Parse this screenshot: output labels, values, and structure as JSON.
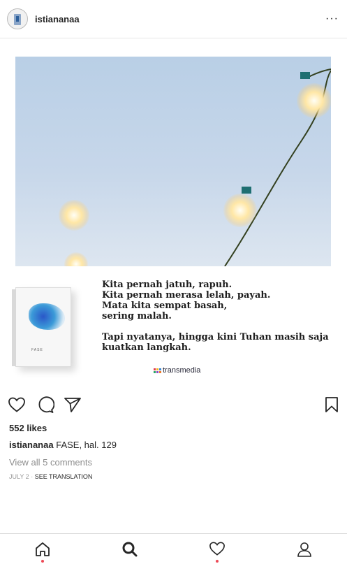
{
  "header": {
    "username": "istiananaa",
    "more_label": "···"
  },
  "post": {
    "quote_lines": [
      "Kita pernah jatuh, rapuh.",
      "Kita pernah merasa lelah, payah.",
      "Mata kita sempat basah,",
      "sering malah.",
      "Tapi nyatanya, hingga kini Tuhan masih saja",
      "kuatkan langkah."
    ],
    "publisher": "transmedia"
  },
  "actions": {
    "like_icon": "heart-icon",
    "comment_icon": "comment-icon",
    "share_icon": "paper-plane-icon",
    "save_icon": "bookmark-icon"
  },
  "likes": "552 likes",
  "caption": {
    "username": "istiananaa",
    "text": "FASE, hal. 129"
  },
  "view_comments": "View all 5 comments",
  "date": "JULY 2",
  "date_separator": " · ",
  "see_translation": "SEE TRANSLATION",
  "tabbar": {
    "items": [
      "home-icon",
      "search-icon",
      "activity-heart-icon",
      "profile-icon"
    ],
    "notification_color": "#ed4956"
  }
}
